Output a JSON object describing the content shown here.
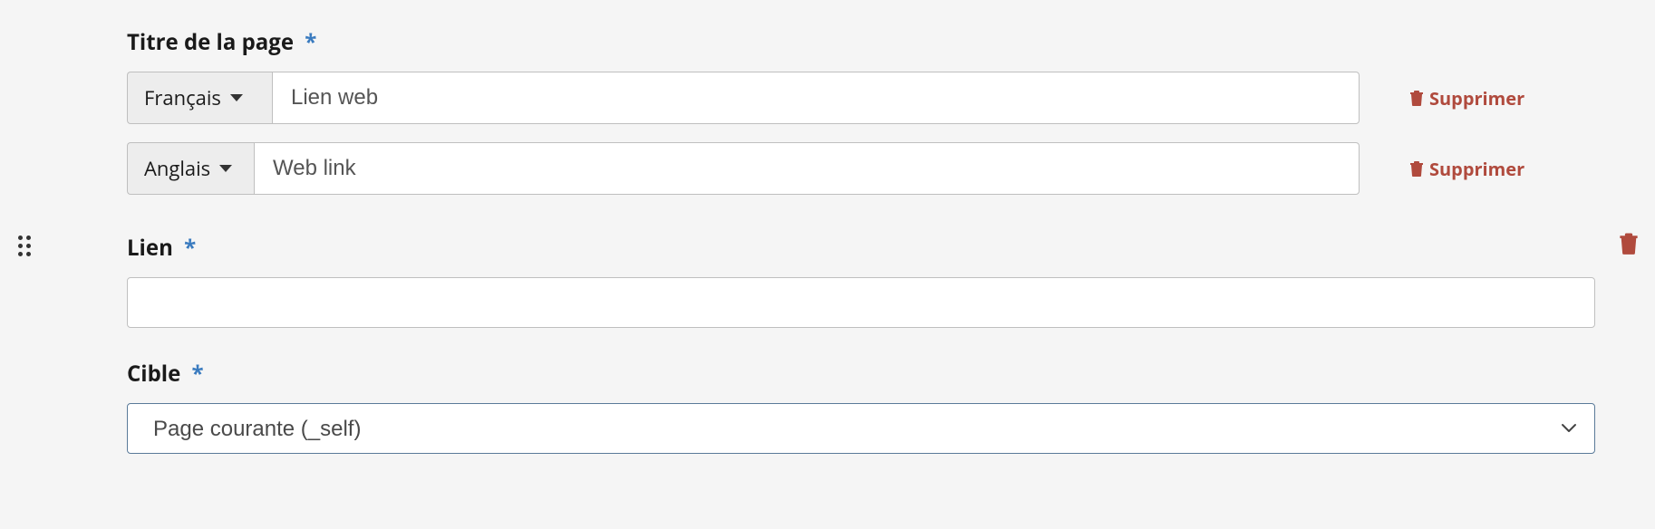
{
  "title_section": {
    "label": "Titre de la page",
    "rows": [
      {
        "lang": "Français",
        "value": "Lien web",
        "delete_label": "Supprimer"
      },
      {
        "lang": "Anglais",
        "value": "Web link",
        "delete_label": "Supprimer"
      }
    ]
  },
  "link_section": {
    "label": "Lien",
    "value": ""
  },
  "target_section": {
    "label": "Cible",
    "selected": "Page courante (_self)"
  },
  "required_mark": "*"
}
